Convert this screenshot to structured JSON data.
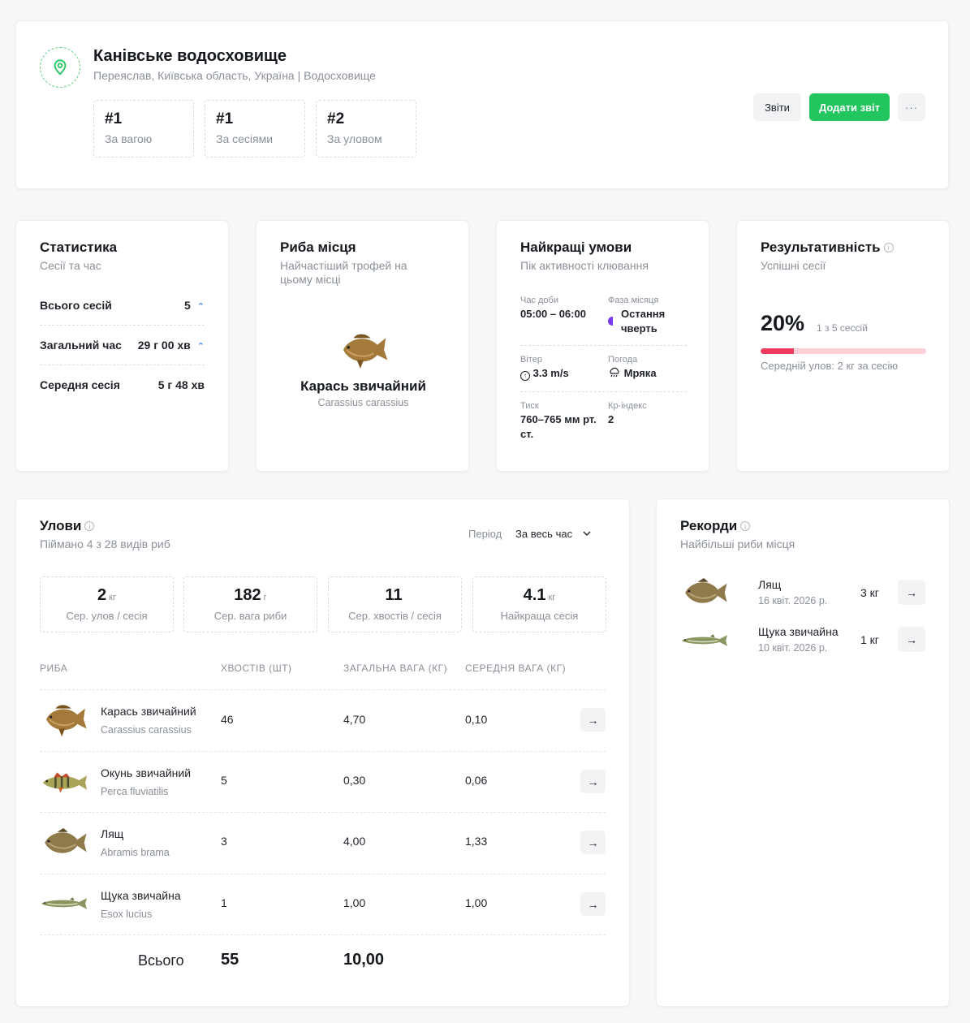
{
  "header": {
    "title": "Канівське водосховище",
    "subtitle": "Переяслав, Київська область, Україна | Водосховище",
    "ranks": [
      {
        "value": "#1",
        "label": "За вагою"
      },
      {
        "value": "#1",
        "label": "За сесіями"
      },
      {
        "value": "#2",
        "label": "За уловом"
      }
    ],
    "buttons": {
      "reports": "Звіти",
      "add_report": "Додати звіт",
      "more": "···"
    }
  },
  "stats": {
    "title": "Статистика",
    "subtitle": "Сесії та час",
    "rows": [
      {
        "label": "Всього сесій",
        "value": "5"
      },
      {
        "label": "Загальний час",
        "value": "29 г 00 хв"
      },
      {
        "label": "Середня сесія",
        "value": "5 г 48 хв"
      }
    ]
  },
  "spot_fish": {
    "title": "Риба місця",
    "subtitle": "Найчастіший трофей на цьому місці",
    "name": "Карась звичайний",
    "latin": "Carassius carassius"
  },
  "conditions": {
    "title": "Найкращі умови",
    "subtitle": "Пік активності клювання",
    "time_label": "Час доби",
    "time_value": "05:00 – 06:00",
    "moon_label": "Фаза місяця",
    "moon_value": "Остання чверть",
    "wind_label": "Вітер",
    "wind_value": "3.3 m/s",
    "weather_label": "Погода",
    "weather_value": "Мряка",
    "pressure_label": "Тиск",
    "pressure_value": "760–765 мм рт. ст.",
    "kp_label": "Кр-індекс",
    "kp_value": "2"
  },
  "performance": {
    "title": "Результативність",
    "subtitle": "Успішні сесії",
    "percent": "20%",
    "sessions": "1 з 5 сессій",
    "progress_fraction": 0.2,
    "avg": "Середній улов: 2 кг за сесію",
    "colors": {
      "bar_fill": "#ef3b5d",
      "bar_track": "#fbd0d8"
    }
  },
  "catches": {
    "title": "Улови",
    "subtitle": "Піймано 4 з 28 видів риб",
    "period_label": "Період",
    "period_value": "За весь час",
    "summary": [
      {
        "value": "2",
        "unit": "кг",
        "label": "Сер. улов / сесія"
      },
      {
        "value": "182",
        "unit": "г",
        "label": "Сер. вага риби"
      },
      {
        "value": "11",
        "unit": "",
        "label": "Сер. хвостів / сесія"
      },
      {
        "value": "4.1",
        "unit": "кг",
        "label": "Найкраща сесія"
      }
    ],
    "columns": [
      "РИБА",
      "ХВОСТІВ (ШТ)",
      "ЗАГАЛЬНА ВАГА (КГ)",
      "СЕРЕДНЯ ВАГА (КГ)"
    ],
    "rows": [
      {
        "name": "Карась звичайний",
        "latin": "Carassius carassius",
        "count": "46",
        "total": "4,70",
        "avg": "0,10"
      },
      {
        "name": "Окунь звичайний",
        "latin": "Perca fluviatilis",
        "count": "5",
        "total": "0,30",
        "avg": "0,06"
      },
      {
        "name": "Лящ",
        "latin": "Abramis brama",
        "count": "3",
        "total": "4,00",
        "avg": "1,33"
      },
      {
        "name": "Щука звичайна",
        "latin": "Esox lucius",
        "count": "1",
        "total": "1,00",
        "avg": "1,00"
      }
    ],
    "total_label": "Всього",
    "total_count": "55",
    "total_weight": "10,00"
  },
  "records": {
    "title": "Рекорди",
    "subtitle": "Найбільші риби місця",
    "items": [
      {
        "name": "Лящ",
        "date": "16 квіт. 2026 р.",
        "weight": "3 кг"
      },
      {
        "name": "Щука звичайна",
        "date": "10 квіт. 2026 р.",
        "weight": "1 кг"
      }
    ]
  },
  "icons": {
    "arrow": "→",
    "chevron_down": "⌄",
    "chevron_up": "⌃",
    "info": "i"
  },
  "colors": {
    "accent_green": "#22c55e",
    "moon_purple": "#7c3aed",
    "chevron_blue": "#3b82f6"
  }
}
